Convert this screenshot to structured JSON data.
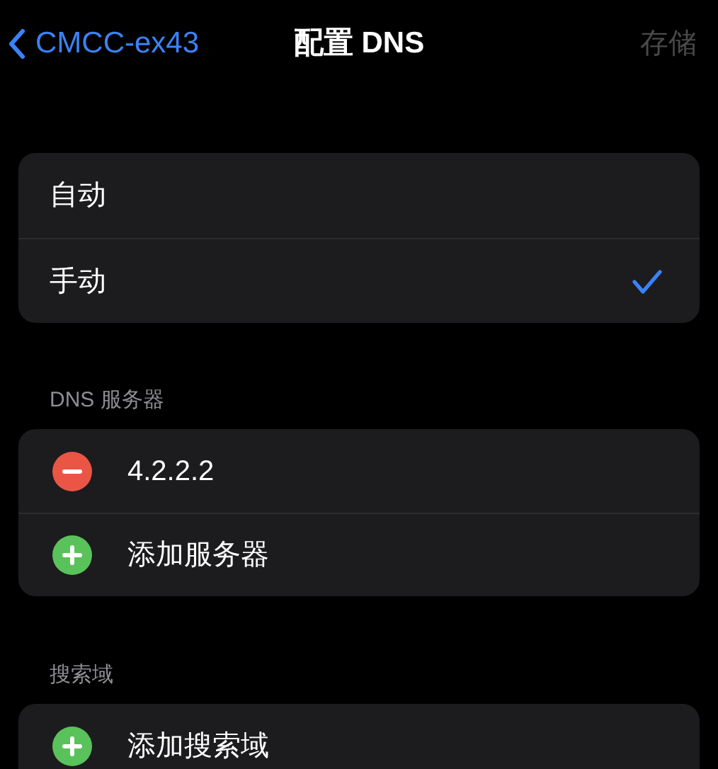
{
  "nav": {
    "back_label": "CMCC-ex43",
    "title": "配置 DNS",
    "action": {
      "label": "存储",
      "disabled": true
    }
  },
  "modes": [
    {
      "label": "自动",
      "selected": false
    },
    {
      "label": "手动",
      "selected": true
    }
  ],
  "sections": [
    {
      "header": "DNS 服务器",
      "rows": [
        {
          "kind": "remove",
          "label": "4.2.2.2"
        },
        {
          "kind": "add",
          "label": "添加服务器"
        }
      ]
    },
    {
      "header": "搜索域",
      "rows": [
        {
          "kind": "add",
          "label": "添加搜索域"
        }
      ]
    }
  ]
}
